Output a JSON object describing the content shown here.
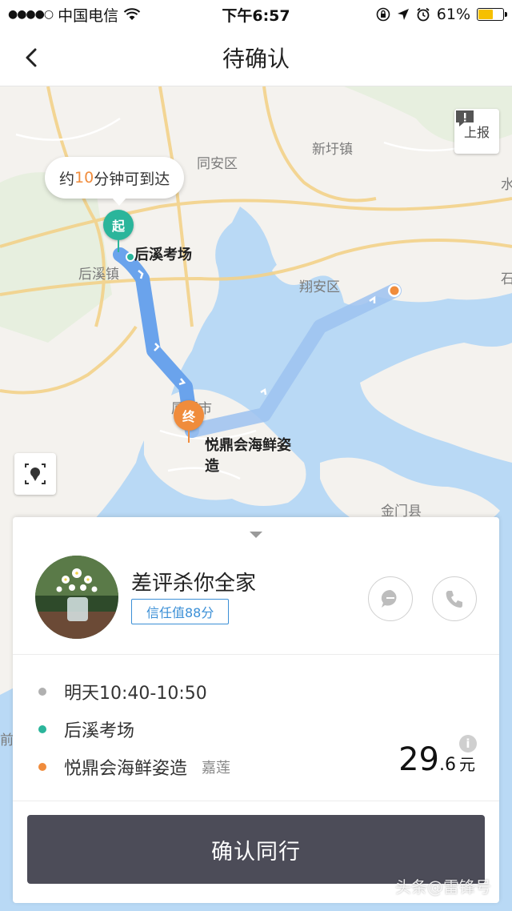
{
  "status_bar": {
    "carrier": "中国电信",
    "time": "下午6:57",
    "battery_percent": "61%",
    "battery_level": 0.61,
    "battery_color": "#f6c000"
  },
  "nav": {
    "back_icon": "chevron-left-icon",
    "title": "待确认"
  },
  "map": {
    "report_button": {
      "icon": "report-icon",
      "label": "上报"
    },
    "eta_bubble": {
      "prefix": "约",
      "minutes": "10",
      "suffix": "分钟可到达"
    },
    "start_pin": {
      "label": "起",
      "color": "#2bb59b"
    },
    "end_pin": {
      "label": "终",
      "color": "#f08c3c"
    },
    "labels": {
      "tongan": "同安区",
      "xinxu": "新圩镇",
      "houxi_town": "后溪镇",
      "xiangan": "翔安区",
      "xiamen": "厦门市",
      "jinmen": "金门县",
      "start_place": "后溪考场",
      "end_place_line1": "悦鼎会海鲜姿",
      "end_place_line2": "造",
      "edge_shui": "水",
      "edge_shi": "石",
      "edge_qian": "前"
    },
    "locate_icon": "locate-icon",
    "route_color": "#6aa3ec",
    "water_color": "#b9d9f5"
  },
  "card": {
    "driver": {
      "name": "差评杀你全家",
      "trust_score": "信任值88分",
      "avatar_icon": "flower-vase-avatar"
    },
    "actions": {
      "message_icon": "message-icon",
      "phone_icon": "phone-icon"
    },
    "trip": {
      "time": "明天10:40-10:50",
      "start": "后溪考场",
      "end": "悦鼎会海鲜姿造",
      "end_area": "嘉莲",
      "time_dot_color": "#b0b0b0",
      "start_dot_color": "#2bb59b",
      "end_dot_color": "#f08c3c"
    },
    "price": {
      "integer": "29",
      "decimal": ".6",
      "unit": "元"
    },
    "info_icon": "info-icon",
    "confirm_label": "确认同行"
  },
  "watermark": "头条@雷锋号"
}
